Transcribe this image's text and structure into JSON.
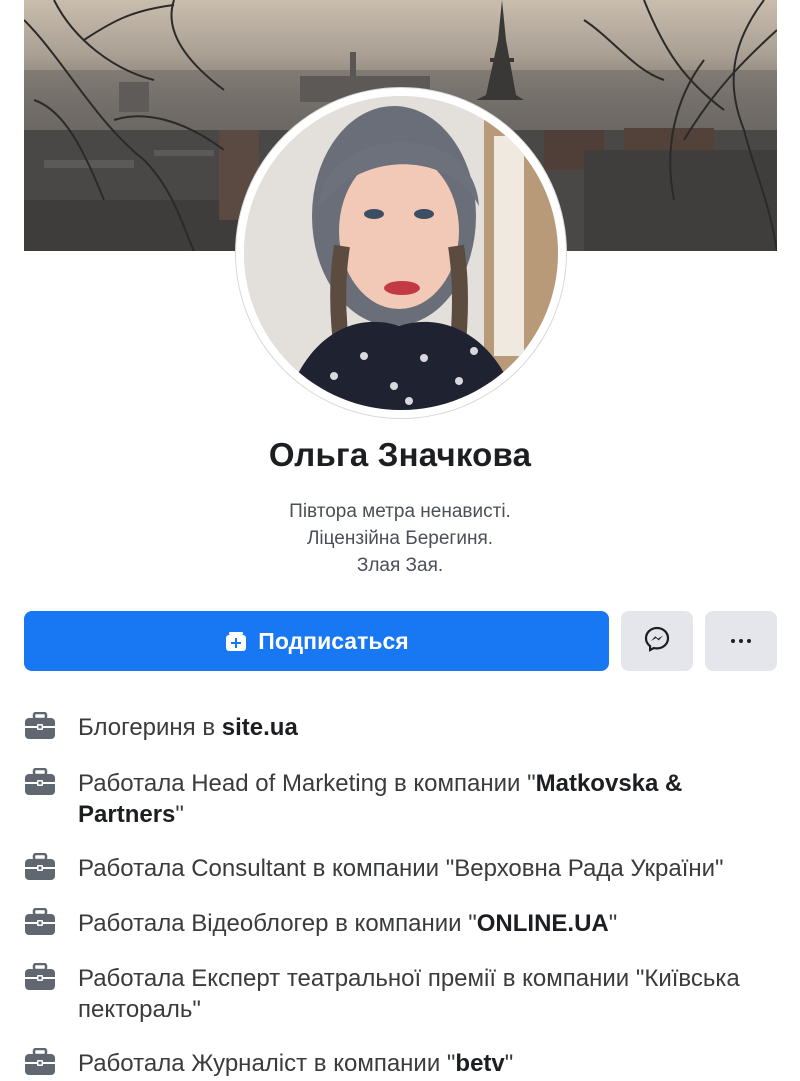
{
  "profile": {
    "name": "Ольга Значкова",
    "bio": [
      "Півтора метра ненависті.",
      "Ліцензійна Берегиня.",
      "Злая Зая."
    ]
  },
  "actions": {
    "subscribe_label": "Подписаться",
    "subscribe_icon": "add-friend-icon",
    "messenger_icon": "messenger-icon",
    "more_icon": "more-dots-icon"
  },
  "work": [
    {
      "prefix": "Блогериня в ",
      "org": "site.ua",
      "suffix": ""
    },
    {
      "prefix": "Работала Head of Marketing в компании \"",
      "org": "Matkovska & Partners",
      "suffix": "\""
    },
    {
      "prefix": "Работала Consultant в компании \"Верховна Рада України\"",
      "org": "",
      "suffix": ""
    },
    {
      "prefix": "Работала Відеоблогер в компании \"",
      "org": "ONLINE.UA",
      "suffix": "\""
    },
    {
      "prefix": "Работала Експерт театральної премії в компании \"Київська пектораль\"",
      "org": "",
      "suffix": ""
    },
    {
      "prefix": "Работала Журналіст в компании \"",
      "org": "betv",
      "suffix": "\""
    }
  ],
  "colors": {
    "accent": "#1877f2",
    "button_gray": "#e4e6eb",
    "icon_gray": "#606770"
  }
}
